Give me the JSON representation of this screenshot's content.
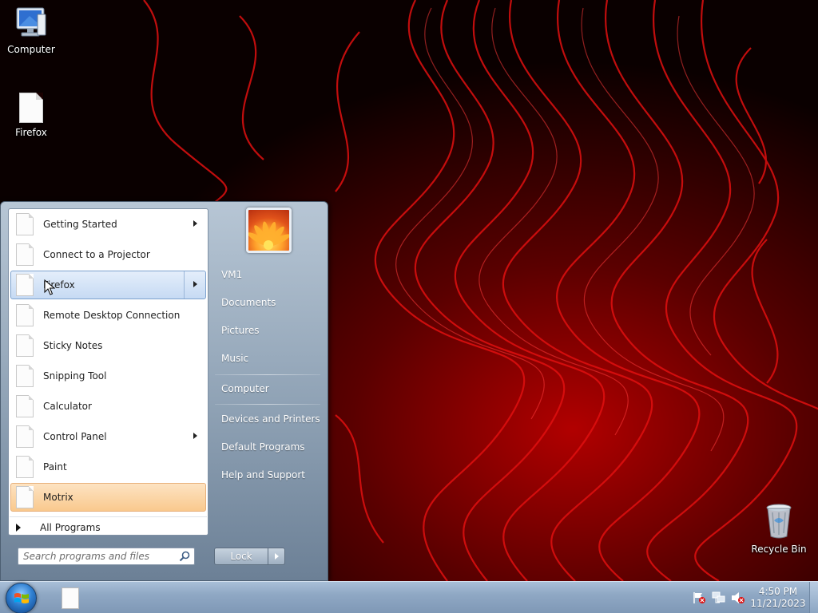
{
  "desktop": {
    "icons": [
      {
        "label": "Computer",
        "icon": "computer-icon"
      },
      {
        "label": "Firefox",
        "icon": "document-icon"
      },
      {
        "label": "Recycle Bin",
        "icon": "recycle-bin-icon"
      }
    ]
  },
  "start_menu": {
    "programs": [
      {
        "label": "Getting Started",
        "has_submenu": true,
        "state": "normal"
      },
      {
        "label": "Connect to a Projector",
        "has_submenu": false,
        "state": "normal"
      },
      {
        "label": "Firefox",
        "has_submenu": true,
        "state": "hover"
      },
      {
        "label": "Remote Desktop Connection",
        "has_submenu": false,
        "state": "normal"
      },
      {
        "label": "Sticky Notes",
        "has_submenu": false,
        "state": "normal"
      },
      {
        "label": "Snipping Tool",
        "has_submenu": false,
        "state": "normal"
      },
      {
        "label": "Calculator",
        "has_submenu": false,
        "state": "normal"
      },
      {
        "label": "Control Panel",
        "has_submenu": true,
        "state": "normal"
      },
      {
        "label": "Paint",
        "has_submenu": false,
        "state": "normal"
      },
      {
        "label": "Motrix",
        "has_submenu": false,
        "state": "highlighted"
      }
    ],
    "all_programs_label": "All Programs",
    "search": {
      "placeholder": "Search programs and files",
      "value": ""
    },
    "user_name": "VM1",
    "right_links": [
      "Documents",
      "Pictures",
      "Music",
      "Computer",
      "Devices and Printers",
      "Default Programs",
      "Help and Support"
    ],
    "lock_label": "Lock"
  },
  "taskbar": {
    "pinned": [
      {
        "icon": "document-icon"
      }
    ],
    "tray_icons": [
      "action-center-flag-icon",
      "network-icon",
      "volume-muted-icon"
    ],
    "time": "4:50 PM",
    "date": "11/21/2023"
  },
  "colors": {
    "wallpaper_red": "#c40000",
    "menu_hover": "#c6daf3",
    "menu_highlight": "#f9c98e",
    "taskbar": "#8fa8c4"
  }
}
